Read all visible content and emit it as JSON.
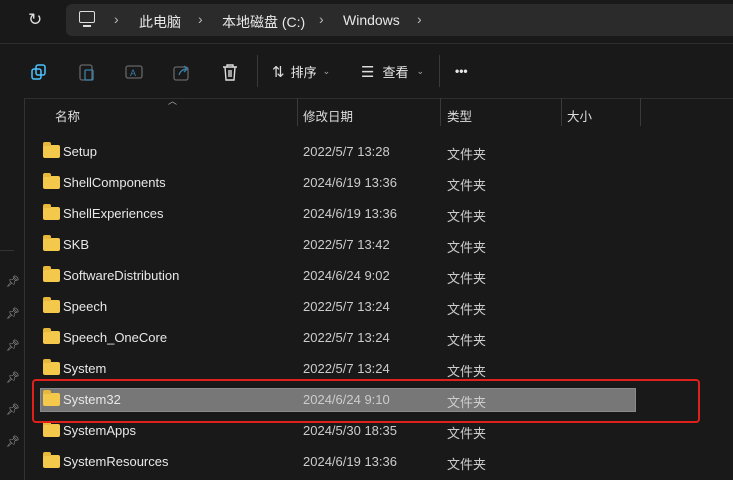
{
  "breadcrumb": [
    "此电脑",
    "本地磁盘 (C:)",
    "Windows"
  ],
  "toolbar": {
    "sort": "排序",
    "view": "查看",
    "more": "•••"
  },
  "columns": {
    "name": "名称",
    "date": "修改日期",
    "type": "类型",
    "size": "大小"
  },
  "rows": [
    {
      "name": "Setup",
      "date": "2022/5/7 13:28",
      "type": "文件夹"
    },
    {
      "name": "ShellComponents",
      "date": "2024/6/19 13:36",
      "type": "文件夹"
    },
    {
      "name": "ShellExperiences",
      "date": "2024/6/19 13:36",
      "type": "文件夹"
    },
    {
      "name": "SKB",
      "date": "2022/5/7 13:42",
      "type": "文件夹"
    },
    {
      "name": "SoftwareDistribution",
      "date": "2024/6/24 9:02",
      "type": "文件夹"
    },
    {
      "name": "Speech",
      "date": "2022/5/7 13:24",
      "type": "文件夹"
    },
    {
      "name": "Speech_OneCore",
      "date": "2022/5/7 13:24",
      "type": "文件夹"
    },
    {
      "name": "System",
      "date": "2022/5/7 13:24",
      "type": "文件夹"
    },
    {
      "name": "System32",
      "date": "2024/6/24 9:10",
      "type": "文件夹",
      "selected": true
    },
    {
      "name": "SystemApps",
      "date": "2024/5/30 18:35",
      "type": "文件夹"
    },
    {
      "name": "SystemResources",
      "date": "2024/6/19 13:36",
      "type": "文件夹"
    }
  ]
}
